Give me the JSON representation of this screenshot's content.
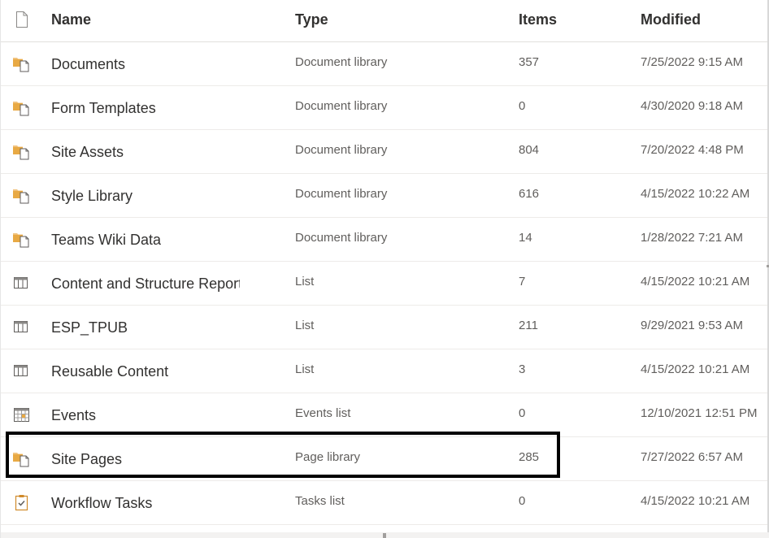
{
  "columns": {
    "name": "Name",
    "type": "Type",
    "items": "Items",
    "modified": "Modified"
  },
  "colors": {
    "folder_accent": "#f1c27d",
    "highlight_border": "#000000"
  },
  "rows": [
    {
      "icon": "document-library-icon",
      "name": "Documents",
      "type": "Document library",
      "items": "357",
      "modified": "7/25/2022 9:15 AM"
    },
    {
      "icon": "document-library-icon",
      "name": "Form Templates",
      "type": "Document library",
      "items": "0",
      "modified": "4/30/2020 9:18 AM"
    },
    {
      "icon": "document-library-icon",
      "name": "Site Assets",
      "type": "Document library",
      "items": "804",
      "modified": "7/20/2022 4:48 PM"
    },
    {
      "icon": "document-library-icon",
      "name": "Style Library",
      "type": "Document library",
      "items": "616",
      "modified": "4/15/2022 10:22 AM"
    },
    {
      "icon": "document-library-icon",
      "name": "Teams Wiki Data",
      "type": "Document library",
      "items": "14",
      "modified": "1/28/2022 7:21 AM"
    },
    {
      "icon": "list-icon",
      "name": "Content and Structure Reports",
      "type": "List",
      "items": "7",
      "modified": "4/15/2022 10:21 AM"
    },
    {
      "icon": "list-icon",
      "name": "ESP_TPUB",
      "type": "List",
      "items": "211",
      "modified": "9/29/2021 9:53 AM"
    },
    {
      "icon": "list-icon",
      "name": "Reusable Content",
      "type": "List",
      "items": "3",
      "modified": "4/15/2022 10:21 AM"
    },
    {
      "icon": "calendar-icon",
      "name": "Events",
      "type": "Events list",
      "items": "0",
      "modified": "12/10/2021 12:51 PM"
    },
    {
      "icon": "page-library-icon",
      "name": "Site Pages",
      "type": "Page library",
      "items": "285",
      "modified": "7/27/2022 6:57 AM"
    },
    {
      "icon": "tasks-list-icon",
      "name": "Workflow Tasks",
      "type": "Tasks list",
      "items": "0",
      "modified": "4/15/2022 10:21 AM"
    }
  ]
}
